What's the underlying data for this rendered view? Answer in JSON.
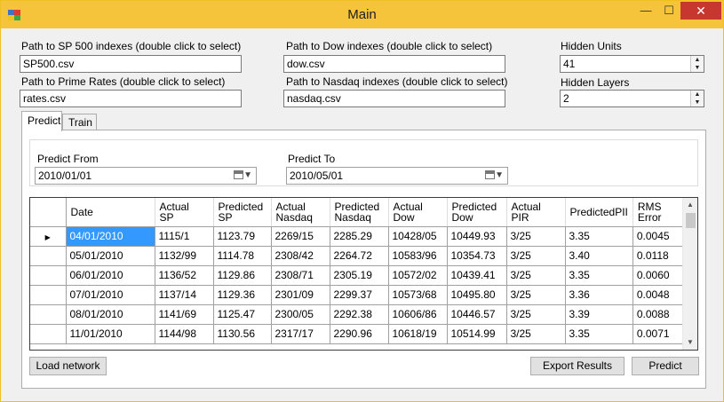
{
  "window": {
    "title": "Main",
    "minimize": "—",
    "maximize": "☐",
    "close": "✕"
  },
  "inputs": {
    "sp500_label": "Path to SP 500 indexes (double click to select)",
    "sp500_value": "SP500.csv",
    "prime_label": "Path to Prime Rates (double click to select)",
    "prime_value": "rates.csv",
    "dow_label": "Path to Dow indexes (double click to select)",
    "dow_value": "dow.csv",
    "nasdaq_label": "Path to Nasdaq indexes (double click to select)",
    "nasdaq_value": "nasdaq.csv",
    "hidden_units_label": "Hidden Units",
    "hidden_units_value": "41",
    "hidden_layers_label": "Hidden Layers",
    "hidden_layers_value": "2"
  },
  "tabs": [
    {
      "label": "Predict",
      "active": true
    },
    {
      "label": "Train",
      "active": false
    }
  ],
  "predict": {
    "from_label": "Predict From",
    "from_value": "2010/01/01",
    "to_label": "Predict To",
    "to_value": "2010/05/01"
  },
  "grid": {
    "columns": [
      [
        "Date"
      ],
      [
        "Actual",
        "SP"
      ],
      [
        "Predicted",
        "SP"
      ],
      [
        "Actual",
        "Nasdaq"
      ],
      [
        "Predicted",
        "Nasdaq"
      ],
      [
        "Actual",
        "Dow"
      ],
      [
        "Predicted",
        "Dow"
      ],
      [
        "Actual",
        "PIR"
      ],
      [
        "PredictedPII"
      ],
      [
        "RMS",
        "Error"
      ]
    ],
    "current_row_marker": "▶",
    "rows": [
      [
        "04/01/2010",
        "1115/1",
        "1123.79",
        "2269/15",
        "2285.29",
        "10428/05",
        "10449.93",
        "3/25",
        "3.35",
        "0.0045"
      ],
      [
        "05/01/2010",
        "1132/99",
        "1114.78",
        "2308/42",
        "2264.72",
        "10583/96",
        "10354.73",
        "3/25",
        "3.40",
        "0.0118"
      ],
      [
        "06/01/2010",
        "1136/52",
        "1129.86",
        "2308/71",
        "2305.19",
        "10572/02",
        "10439.41",
        "3/25",
        "3.35",
        "0.0060"
      ],
      [
        "07/01/2010",
        "1137/14",
        "1129.36",
        "2301/09",
        "2299.37",
        "10573/68",
        "10495.80",
        "3/25",
        "3.36",
        "0.0048"
      ],
      [
        "08/01/2010",
        "1141/69",
        "1125.47",
        "2300/05",
        "2292.38",
        "10606/86",
        "10446.57",
        "3/25",
        "3.39",
        "0.0088"
      ],
      [
        "11/01/2010",
        "1144/98",
        "1130.56",
        "2317/17",
        "2290.96",
        "10618/19",
        "10514.99",
        "3/25",
        "3.35",
        "0.0071"
      ]
    ]
  },
  "buttons": {
    "load_network": "Load network",
    "export_results": "Export Results",
    "predict": "Predict"
  },
  "colors": {
    "titlebar": "#f5c43a",
    "selection": "#3399ff",
    "close": "#c7372f"
  }
}
